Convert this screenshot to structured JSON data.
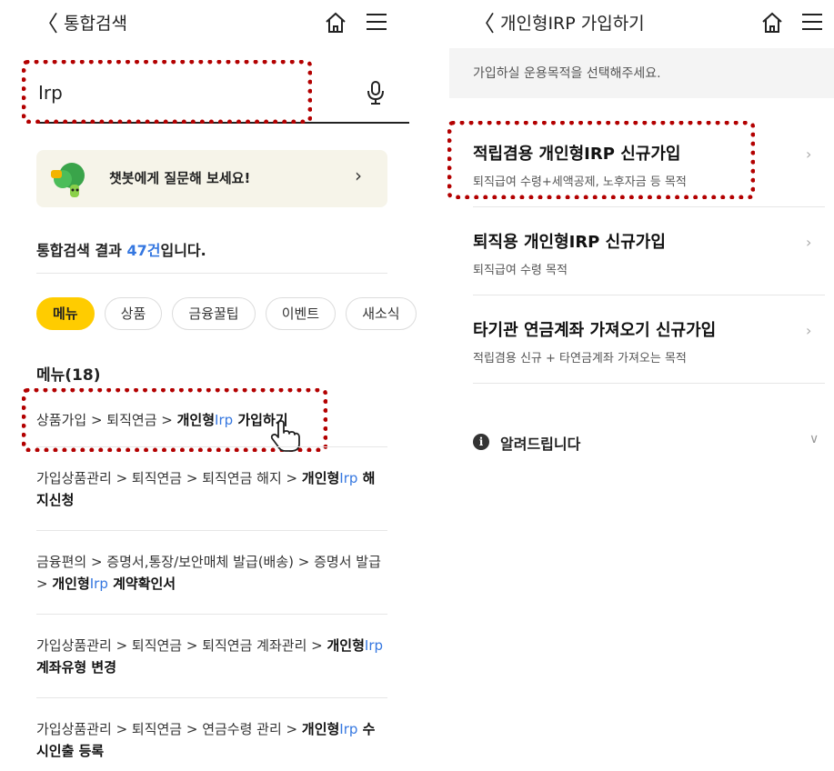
{
  "left": {
    "header": {
      "back_icon": "chevron-left-icon",
      "title": "통합검색"
    },
    "search": {
      "value": "Irp"
    },
    "chatbot": {
      "label": "챗봇에게 질문해 보세요!"
    },
    "result": {
      "prefix": "통합검색 결과 ",
      "count": "47건",
      "suffix": "입니다."
    },
    "chips": [
      "메뉴",
      "상품",
      "금융꿀팁",
      "이벤트",
      "새소식"
    ],
    "menu_count": "메뉴(18)",
    "items": [
      {
        "plain": "상품가입 > 퇴직연금 > ",
        "bold": "개인형",
        "hl": "Irp",
        "after": " 가입하기",
        "after_bold": true
      },
      {
        "plain": "가입상품관리 > 퇴직연금 > 퇴직연금 해지 > ",
        "bold": "개인형",
        "hl": "Irp",
        "after": " 해지신청",
        "after_bold": true
      },
      {
        "plain": "금융편의 > 증명서,통장/보안매체 발급(배송) > 증명서 발급 > ",
        "bold": "개인형",
        "hl": "Irp",
        "after": " 계약확인서",
        "after_bold": true
      },
      {
        "plain": "가입상품관리 > 퇴직연금 > 퇴직연금 계좌관리 > ",
        "bold": "개인형",
        "hl": "Irp",
        "after": " 계좌유형 변경",
        "after_bold": true
      },
      {
        "plain": "가입상품관리 > 퇴직연금 > 연금수령 관리 > ",
        "bold": "개인형",
        "hl": "Irp",
        "after": " 수시인출 등록",
        "after_bold": true
      }
    ]
  },
  "right": {
    "header": {
      "back_icon": "chevron-left-icon",
      "title": "개인형IRP 가입하기"
    },
    "notice": "가입하실 운용목적을 선택해주세요.",
    "options": [
      {
        "title": "적립겸용 개인형IRP 신규가입",
        "sub": "퇴직급여 수령+세액공제, 노후자금 등 목적"
      },
      {
        "title": "퇴직용 개인형IRP 신규가입",
        "sub": "퇴직급여 수령 목적"
      },
      {
        "title": "타기관 연금계좌 가져오기 신규가입",
        "sub": "적립겸용 신규 + 타연금계좌 가져오는 목적"
      }
    ],
    "info": "알려드립니다"
  },
  "colors": {
    "accent": "#ffcc00",
    "highlight": "#3577e0",
    "annotation": "#b30000"
  }
}
